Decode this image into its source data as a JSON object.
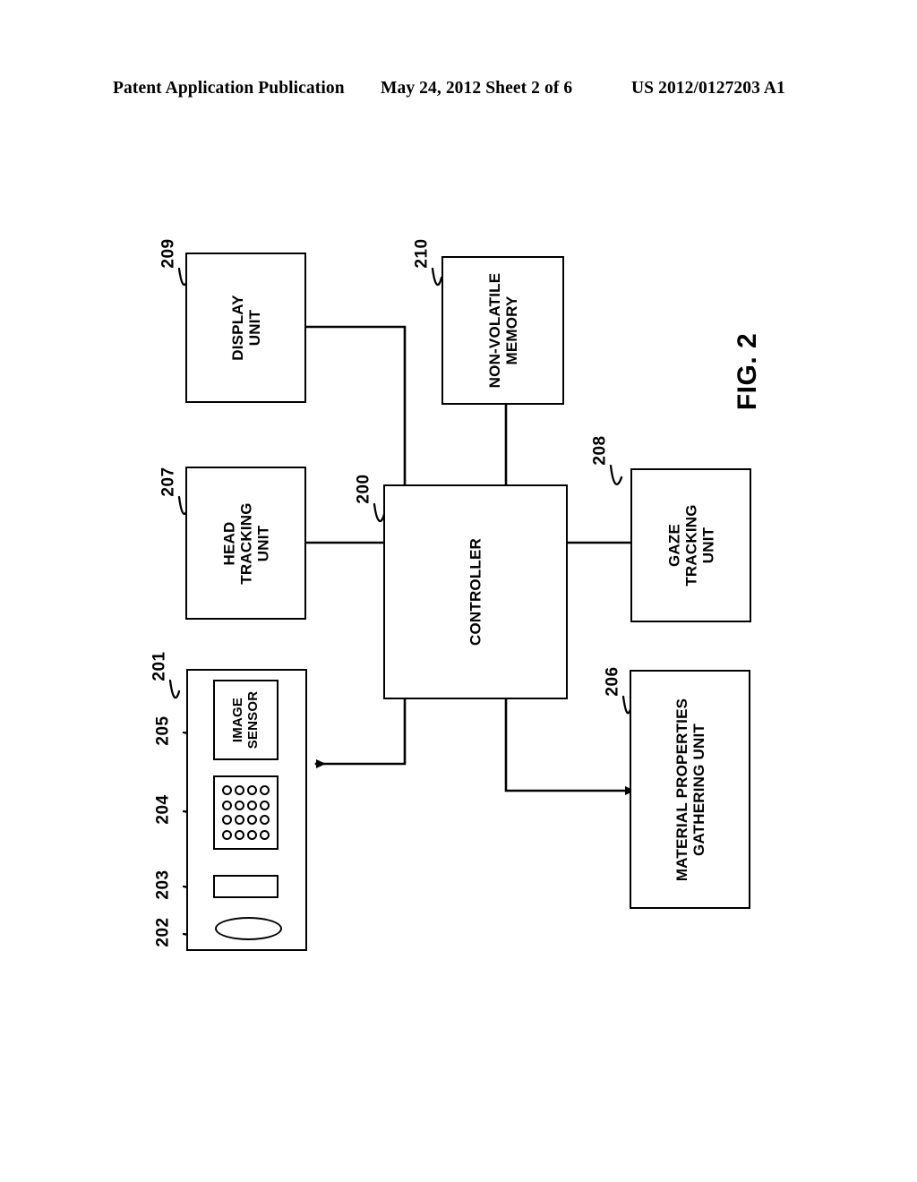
{
  "header": {
    "left": "Patent Application Publication",
    "middle": "May 24, 2012  Sheet 2 of 6",
    "right": "US 2012/0127203 A1"
  },
  "figure": {
    "caption": "FIG. 2",
    "blocks": [
      {
        "id": "display-unit",
        "ref": "209",
        "label": "DISPLAY\nUNIT"
      },
      {
        "id": "non-volatile-memory",
        "ref": "210",
        "label": "NON-VOLATILE\nMEMORY"
      },
      {
        "id": "head-tracking-unit",
        "ref": "207",
        "label": "HEAD\nTRACKING\nUNIT"
      },
      {
        "id": "controller",
        "ref": "200",
        "label": "CONTROLLER"
      },
      {
        "id": "gaze-tracking-unit",
        "ref": "208",
        "label": "GAZE\nTRACKING\nUNIT"
      },
      {
        "id": "material-properties-gathering-unit",
        "ref": "206",
        "label": "MATERIAL PROPERTIES\nGATHERING UNIT"
      },
      {
        "id": "capture-assembly",
        "ref": "201",
        "label": ""
      },
      {
        "id": "image-sensor",
        "ref": "205",
        "label": "IMAGE\nSENSOR"
      },
      {
        "id": "emitter-array",
        "ref": "204",
        "label": ""
      },
      {
        "id": "light-source",
        "ref": "203",
        "label": ""
      },
      {
        "id": "lens",
        "ref": "202",
        "label": ""
      }
    ],
    "refs": {
      "r200": "200",
      "r201": "201",
      "r202": "202",
      "r203": "203",
      "r204": "204",
      "r205": "205",
      "r206": "206",
      "r207": "207",
      "r208": "208",
      "r209": "209",
      "r210": "210"
    },
    "labels": {
      "display_unit": "DISPLAY\nUNIT",
      "non_volatile_memory": "NON-VOLATILE\nMEMORY",
      "head_tracking_unit": "HEAD\nTRACKING\nUNIT",
      "controller": "CONTROLLER",
      "gaze_tracking_unit": "GAZE\nTRACKING\nUNIT",
      "material_properties_gathering_unit": "MATERIAL PROPERTIES\nGATHERING UNIT",
      "image_sensor": "IMAGE\nSENSOR"
    },
    "dot_grid": {
      "rows": 4,
      "cols": 4,
      "count": 16
    },
    "line_color": "#000000"
  }
}
